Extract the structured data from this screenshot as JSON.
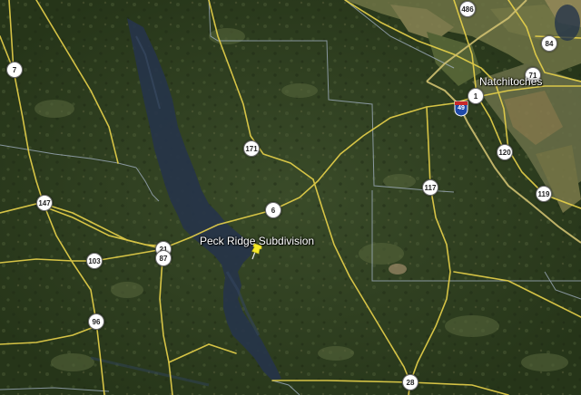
{
  "map": {
    "places": {
      "peck_ridge": "Peck Ridge Subdivision",
      "natchitoches": "Natchitoches"
    },
    "highway_shields": {
      "us_486": "486",
      "us_84": "84",
      "us_71": "71",
      "us_1": "1",
      "us_7": "7",
      "us_171": "171",
      "us_120": "120",
      "us_117": "117",
      "us_119": "119",
      "us_6": "6",
      "us_147": "147",
      "us_21": "21",
      "us_87": "87",
      "us_103": "103",
      "us_96": "96",
      "us_28": "28"
    },
    "interstate_shields": {
      "i_49": "49"
    },
    "pin_icon": "yellow-pushpin-icon",
    "colors": {
      "forest": "#2f4223",
      "water": "#27364a",
      "road": "#e8d24a",
      "boundary": "#a6b4c8",
      "pin": "#f3e928"
    }
  }
}
